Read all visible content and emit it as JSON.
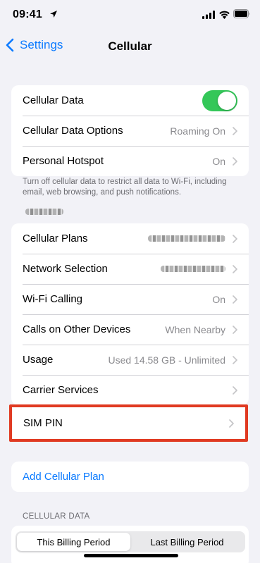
{
  "status_bar": {
    "time": "09:41",
    "icons": [
      "location-arrow-icon",
      "cellular-signal-icon",
      "wifi-icon",
      "battery-icon"
    ]
  },
  "nav": {
    "back_label": "Settings",
    "title": "Cellular"
  },
  "group1": {
    "cellular_data_label": "Cellular Data",
    "cellular_data_on": true,
    "options_label": "Cellular Data Options",
    "options_value": "Roaming On",
    "hotspot_label": "Personal Hotspot",
    "hotspot_value": "On"
  },
  "footnote": "Turn off cellular data to restrict all data to Wi-Fi, including email, web browsing, and push notifications.",
  "group2": {
    "plans_label": "Cellular Plans",
    "network_label": "Network Selection",
    "wifi_calling_label": "Wi-Fi Calling",
    "wifi_calling_value": "On",
    "other_devices_label": "Calls on Other Devices",
    "other_devices_value": "When Nearby",
    "usage_label": "Usage",
    "usage_value": "Used 14.58 GB - Unlimited",
    "carrier_label": "Carrier Services"
  },
  "sim_pin": {
    "label": "SIM PIN"
  },
  "add_plan": {
    "label": "Add Cellular Plan"
  },
  "cellular_data_section": {
    "header": "CELLULAR DATA",
    "tabs": [
      "This Billing Period",
      "Last Billing Period"
    ],
    "active_tab": "This Billing Period"
  },
  "colors": {
    "accent": "#0a7aff",
    "toggle_on": "#34c759",
    "highlight": "#e03a22",
    "background": "#f2f2f7"
  }
}
